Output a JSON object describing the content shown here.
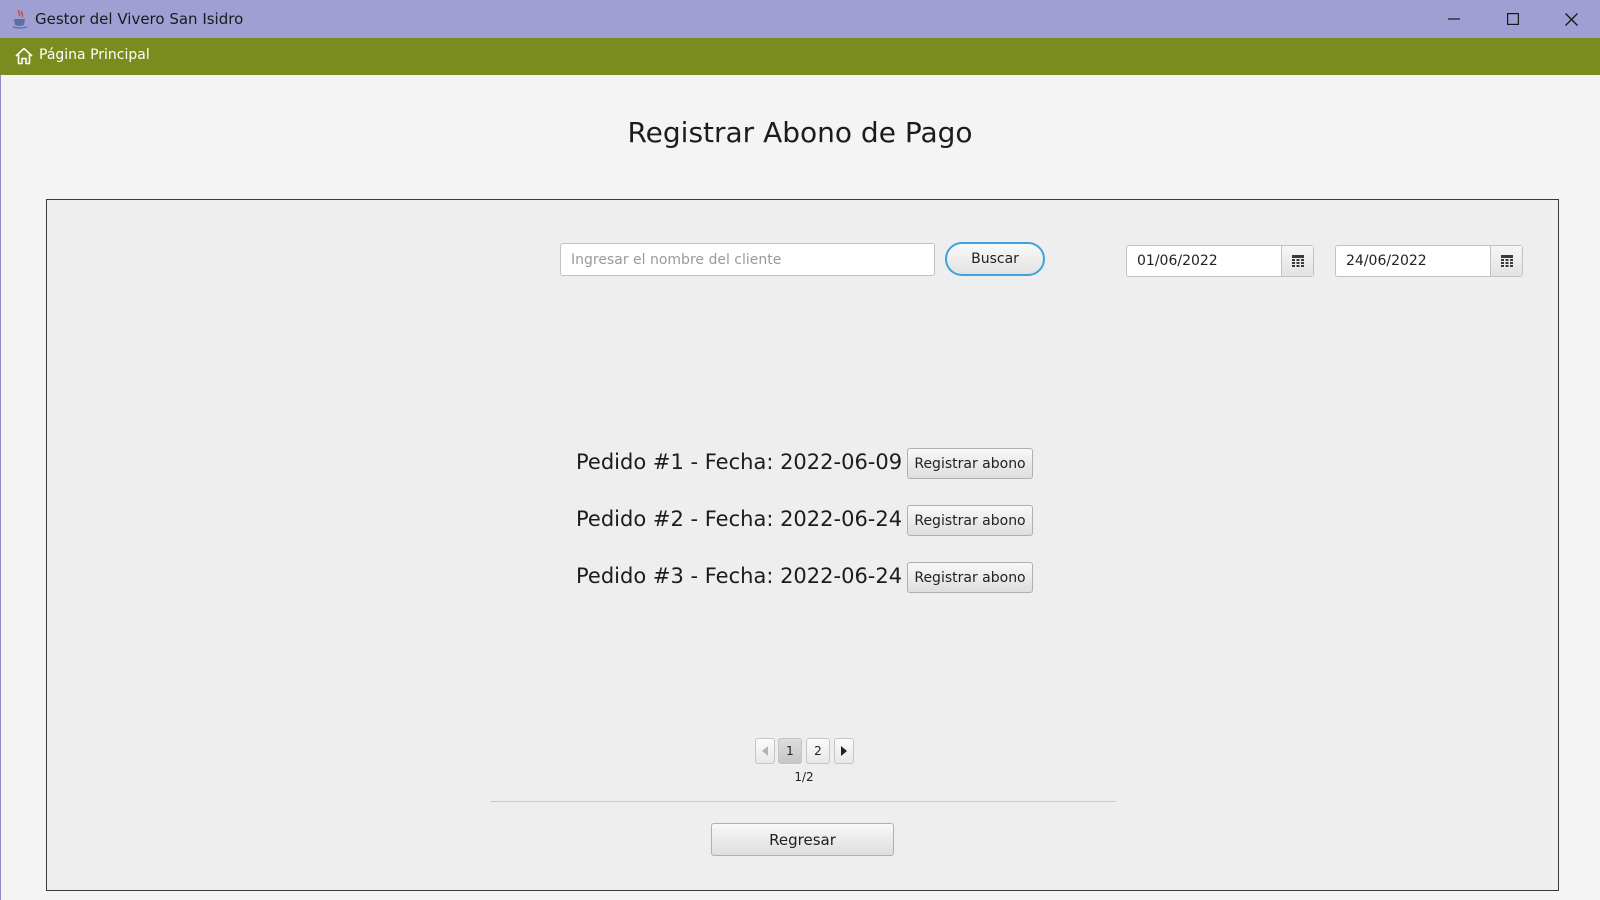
{
  "window": {
    "title": "Gestor del Vivero San Isidro",
    "app_icon": "java-cup-icon",
    "controls": [
      "minimize-icon",
      "maximize-icon",
      "close-icon"
    ]
  },
  "navbar": {
    "home_icon": "home-icon",
    "home_label": "Página Principal",
    "color": "#7a8c1e"
  },
  "titlebar_color": "#9f9fd3",
  "page": {
    "title": "Registrar Abono de Pago"
  },
  "search": {
    "placeholder": "Ingresar el nombre del cliente",
    "value": "",
    "button_label": "Buscar",
    "focus_color": "#3fa2dc"
  },
  "date_range": {
    "from": "01/06/2022",
    "to": "24/06/2022",
    "calendar_icon": "calendar-icon"
  },
  "orders": [
    {
      "label": "Pedido #1 - Fecha: 2022-06-09",
      "button_label": "Registrar abono"
    },
    {
      "label": "Pedido #2 - Fecha: 2022-06-24",
      "button_label": "Registrar abono"
    },
    {
      "label": "Pedido #3 - Fecha: 2022-06-24",
      "button_label": "Registrar abono"
    }
  ],
  "pagination": {
    "pages": [
      "1",
      "2"
    ],
    "current_page": 1,
    "status": "1/2",
    "prev_icon": "chevron-left-icon",
    "next_icon": "chevron-right-icon"
  },
  "footer": {
    "back_label": "Regresar"
  }
}
